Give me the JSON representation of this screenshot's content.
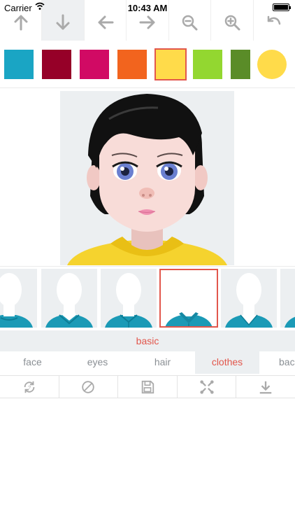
{
  "status_bar": {
    "carrier": "Carrier",
    "time": "10:43 AM"
  },
  "toolbar": {
    "buttons": [
      {
        "icon": "arrow-up-icon"
      },
      {
        "icon": "arrow-down-icon",
        "active": true
      },
      {
        "icon": "arrow-left-icon"
      },
      {
        "icon": "arrow-right-icon"
      },
      {
        "icon": "zoom-out-icon"
      },
      {
        "icon": "zoom-in-icon"
      },
      {
        "icon": "undo-icon"
      }
    ]
  },
  "color_swatches": [
    {
      "color": "#1aa5c4",
      "shape": "square"
    },
    {
      "color": "#960028",
      "shape": "square"
    },
    {
      "color": "#d10a64",
      "shape": "square"
    },
    {
      "color": "#f2641e",
      "shape": "square"
    },
    {
      "color": "#ffdb4a",
      "shape": "square",
      "selected": true
    },
    {
      "color": "#93d730",
      "shape": "square"
    },
    {
      "color": "#5a8c28",
      "shape": "square"
    },
    {
      "color": "#ffdb4a",
      "shape": "circle"
    }
  ],
  "preview": {
    "hair_color": "#111111",
    "skin_color": "#f8dcd8",
    "eye_color": "#6a7fd0",
    "shirt_color": "#f5d32e",
    "background_color": "#eceff1"
  },
  "thumbnails": {
    "shirt_color": "#1b9ab6",
    "items": [
      {
        "style": "crew-neck"
      },
      {
        "style": "collar"
      },
      {
        "style": "polo"
      },
      {
        "style": "polo-open",
        "selected": true
      },
      {
        "style": "v-neck"
      },
      {
        "style": "crew-neck"
      }
    ]
  },
  "subcategory": {
    "label": "basic"
  },
  "tabs": [
    {
      "label": "face"
    },
    {
      "label": "eyes"
    },
    {
      "label": "hair"
    },
    {
      "label": "clothes",
      "active": true
    },
    {
      "label": "back"
    }
  ],
  "actions": [
    {
      "icon": "random-icon"
    },
    {
      "icon": "reset-icon"
    },
    {
      "icon": "save-icon"
    },
    {
      "icon": "fullscreen-icon"
    },
    {
      "icon": "download-icon"
    }
  ],
  "colors": {
    "accent": "#e2574c",
    "icon_gray": "#aaaaaa",
    "panel_bg": "#eceff1"
  }
}
